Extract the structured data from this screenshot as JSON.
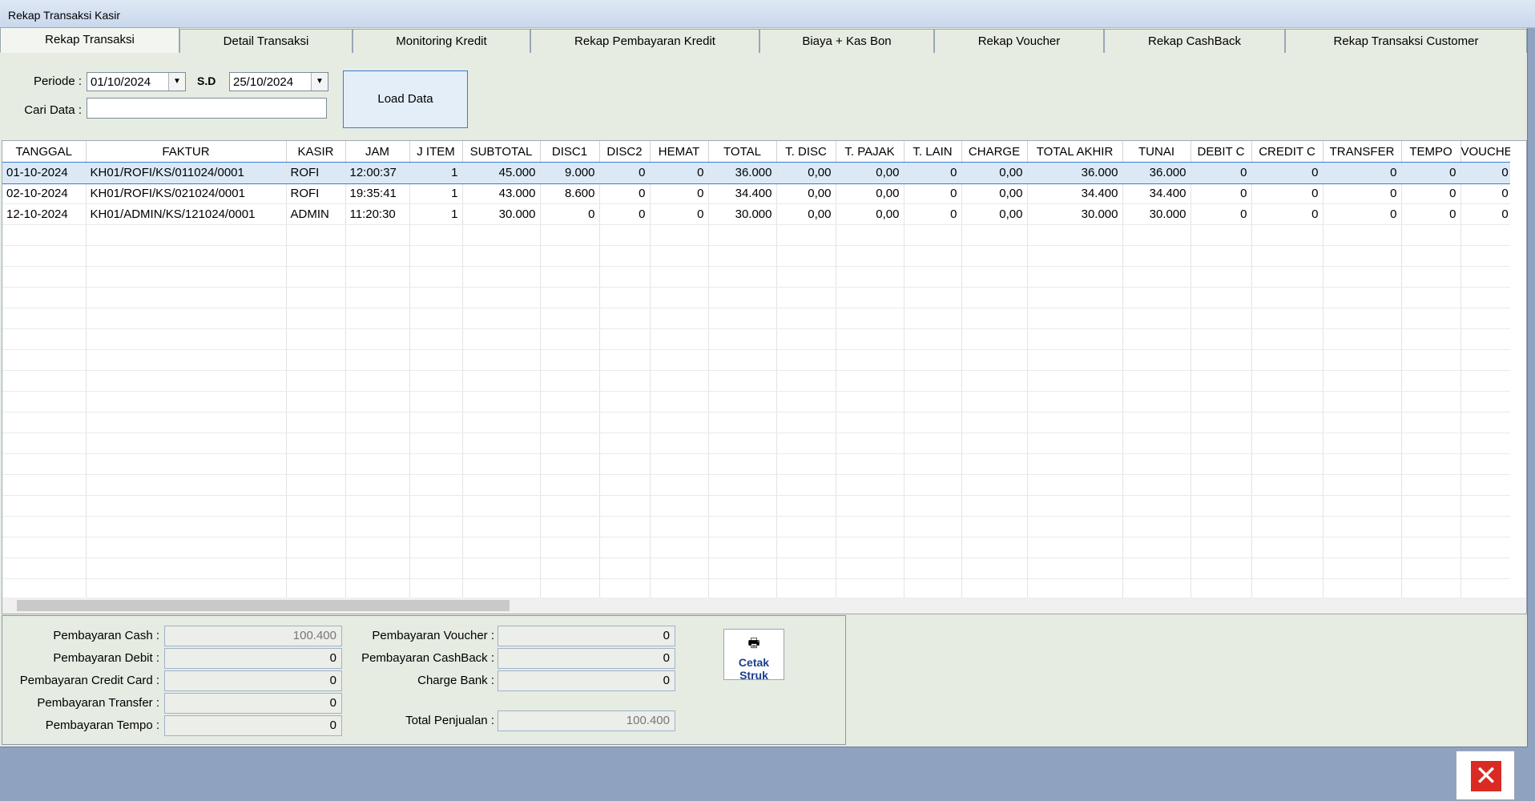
{
  "window_title": "Rekap Transaksi Kasir",
  "tabs": [
    "Rekap Transaksi",
    "Detail Transaksi",
    "Monitoring Kredit",
    "Rekap Pembayaran Kredit",
    "Biaya + Kas Bon",
    "Rekap Voucher",
    "Rekap CashBack",
    "Rekap Transaksi Customer"
  ],
  "filters": {
    "periode_label": "Periode :",
    "date_from": "01/10/2024",
    "sd_label": "S.D",
    "date_to": "25/10/2024",
    "cari_label": "Cari Data :",
    "cari_value": "",
    "load_button": "Load Data"
  },
  "grid": {
    "columns": [
      "TANGGAL",
      "FAKTUR",
      "KASIR",
      "JAM",
      "J ITEM",
      "SUBTOTAL",
      "DISC1",
      "DISC2",
      "HEMAT",
      "TOTAL",
      "T. DISC",
      "T. PAJAK",
      "T. LAIN",
      "CHARGE",
      "TOTAL AKHIR",
      "TUNAI",
      "DEBIT C",
      "CREDIT C",
      "TRANSFER",
      "TEMPO",
      "VOUCHE"
    ],
    "rows": [
      [
        "01-10-2024",
        "KH01/ROFI/KS/011024/0001",
        "ROFI",
        "12:00:37",
        "1",
        "45.000",
        "9.000",
        "0",
        "0",
        "36.000",
        "0,00",
        "0,00",
        "0",
        "0,00",
        "36.000",
        "36.000",
        "0",
        "0",
        "0",
        "0",
        "0"
      ],
      [
        "02-10-2024",
        "KH01/ROFI/KS/021024/0001",
        "ROFI",
        "19:35:41",
        "1",
        "43.000",
        "8.600",
        "0",
        "0",
        "34.400",
        "0,00",
        "0,00",
        "0",
        "0,00",
        "34.400",
        "34.400",
        "0",
        "0",
        "0",
        "0",
        "0"
      ],
      [
        "12-10-2024",
        "KH01/ADMIN/KS/121024/0001",
        "ADMIN",
        "11:20:30",
        "1",
        "30.000",
        "0",
        "0",
        "0",
        "30.000",
        "0,00",
        "0,00",
        "0",
        "0,00",
        "30.000",
        "30.000",
        "0",
        "0",
        "0",
        "0",
        "0"
      ]
    ]
  },
  "summary": {
    "cash_label": "Pembayaran Cash :",
    "cash_value": "100.400",
    "debit_label": "Pembayaran Debit :",
    "debit_value": "0",
    "credit_label": "Pembayaran Credit Card :",
    "credit_value": "0",
    "transfer_label": "Pembayaran Transfer :",
    "transfer_value": "0",
    "tempo_label": "Pembayaran Tempo :",
    "tempo_value": "0",
    "voucher_label": "Pembayaran Voucher :",
    "voucher_value": "0",
    "cashback_label": "Pembayaran CashBack :",
    "cashback_value": "0",
    "charge_label": "Charge Bank :",
    "charge_value": "0",
    "total_label": "Total Penjualan :",
    "total_value": "100.400"
  },
  "buttons": {
    "print_line1": "Cetak",
    "print_line2": "Struk"
  },
  "icons": {
    "print": "printer-icon",
    "close": "close-icon",
    "dropdown": "chevron-down-icon"
  }
}
